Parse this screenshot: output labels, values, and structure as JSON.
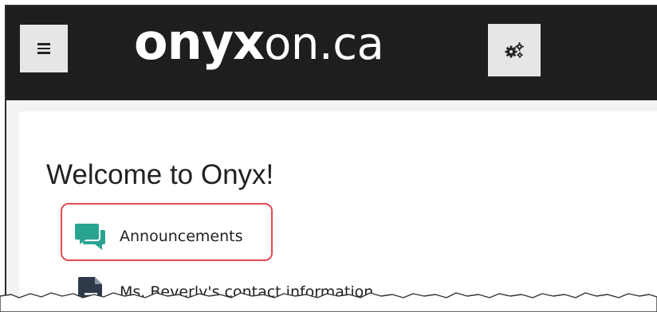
{
  "header": {
    "menu_icon": "hamburger-menu-icon",
    "logo_bold": "onyx",
    "logo_light": "on.ca",
    "settings_icon": "gears-icon",
    "background_color": "#1e1e1e"
  },
  "main": {
    "title": "Welcome to Onyx!",
    "links": [
      {
        "label": "Announcements",
        "icon": "chat-bubbles-icon",
        "icon_color": "#2aa492",
        "highlighted": true
      },
      {
        "label": "Ms. Beverly's contact information",
        "icon": "document-icon",
        "icon_color": "#2e3a4a",
        "highlighted": false
      }
    ]
  },
  "annotation": {
    "highlight_color": "#e34a4f"
  }
}
